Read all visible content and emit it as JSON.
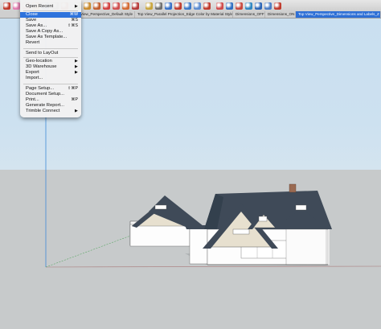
{
  "toolbar": {
    "tool_icons": [
      {
        "name": "select-tool-icon",
        "color": "#c0392b"
      },
      {
        "name": "eraser-tool-icon",
        "color": "#e37db0"
      },
      {
        "name": "pencil-tool-icon",
        "color": "#d14b4b"
      },
      {
        "name": "component-tool-icon",
        "color": "#d29a2c"
      },
      {
        "name": "paint-tool-icon",
        "color": "#3b6fc2"
      },
      {
        "name": "line-tool-icon",
        "color": "#8d8d8d"
      },
      {
        "name": "arc-tool-icon",
        "color": "#c0392b"
      },
      {
        "name": "rectangle-tool-icon",
        "color": "#7e9c3a"
      },
      {
        "name": "pushpull-tool-icon",
        "color": "#c98b2d"
      },
      {
        "name": "offset-tool-icon",
        "color": "#c25d2e"
      },
      {
        "name": "move-tool-icon",
        "color": "#d23f3f"
      },
      {
        "name": "rotate-tool-icon",
        "color": "#d04f4f"
      },
      {
        "name": "scale-tool-icon",
        "color": "#d46a33"
      },
      {
        "name": "followme-tool-icon",
        "color": "#b63939"
      },
      {
        "name": "tape-tool-icon",
        "color": "#c8a43a"
      },
      {
        "name": "text-tool-icon",
        "color": "#6e6e6e"
      },
      {
        "name": "orbit-tool-icon",
        "color": "#3570c9"
      },
      {
        "name": "pan-tool-icon",
        "color": "#c0392b"
      },
      {
        "name": "zoom-tool-icon",
        "color": "#3a78c8"
      },
      {
        "name": "zoom-extents-icon",
        "color": "#5b8bd0"
      },
      {
        "name": "warehouse-icon",
        "color": "#c0392b"
      },
      {
        "name": "extension-icon",
        "color": "#d04a4a"
      },
      {
        "name": "layout-icon",
        "color": "#2f6fc2"
      },
      {
        "name": "section-plane-icon",
        "color": "#c9463a"
      },
      {
        "name": "xray-icon",
        "color": "#2e86c1"
      },
      {
        "name": "shadows-icon",
        "color": "#2b64b6"
      },
      {
        "name": "fog-icon",
        "color": "#4a7cc4"
      },
      {
        "name": "styles-icon",
        "color": "#c0392b"
      }
    ]
  },
  "scene_tabs": [
    {
      "label": "View_Perspective_Default Style",
      "active": false
    },
    {
      "label": "Top View_Parallel Projection_Edge Color by Material Style",
      "active": false
    },
    {
      "label": "Dimensions_OFF",
      "active": false
    },
    {
      "label": "Dimensions_ON",
      "active": false
    },
    {
      "label": "Top View_Perspective_Dimensions and Labels_Z",
      "active": true
    }
  ],
  "file_menu": {
    "items": [
      {
        "label": "Open Recent",
        "shortcut": "▶",
        "highlight": false
      },
      {
        "label": "Close",
        "shortcut": "⌘W",
        "highlight": true
      },
      {
        "label": "Save",
        "shortcut": "⌘S",
        "highlight": false
      },
      {
        "label": "Save As...",
        "shortcut": "⇧⌘S",
        "highlight": false
      },
      {
        "label": "Save A Copy As...",
        "shortcut": "",
        "highlight": false
      },
      {
        "label": "Save As Template...",
        "shortcut": "",
        "highlight": false
      },
      {
        "label": "Revert",
        "shortcut": "",
        "highlight": false
      },
      {
        "label": "Send to LayOut",
        "shortcut": "",
        "highlight": false
      },
      {
        "label": "Geo-location",
        "shortcut": "▶",
        "highlight": false
      },
      {
        "label": "3D Warehouse",
        "shortcut": "▶",
        "highlight": false
      },
      {
        "label": "Export",
        "shortcut": "▶",
        "highlight": false
      },
      {
        "label": "Import...",
        "shortcut": "",
        "highlight": false
      },
      {
        "label": "Page Setup...",
        "shortcut": "⇧⌘P",
        "highlight": false
      },
      {
        "label": "Document Setup...",
        "shortcut": "",
        "highlight": false
      },
      {
        "label": "Print...",
        "shortcut": "⌘P",
        "highlight": false
      },
      {
        "label": "Generate Report...",
        "shortcut": "",
        "highlight": false
      },
      {
        "label": "Trimble Connect",
        "shortcut": "▶",
        "highlight": false
      }
    ]
  },
  "viewport": {
    "sky_color": "#cce0f0",
    "ground_color": "#c7cacb",
    "roof_color": "#3f4a58",
    "wall_color": "#ffffff",
    "gable_siding_color": "#e7e0cf"
  }
}
